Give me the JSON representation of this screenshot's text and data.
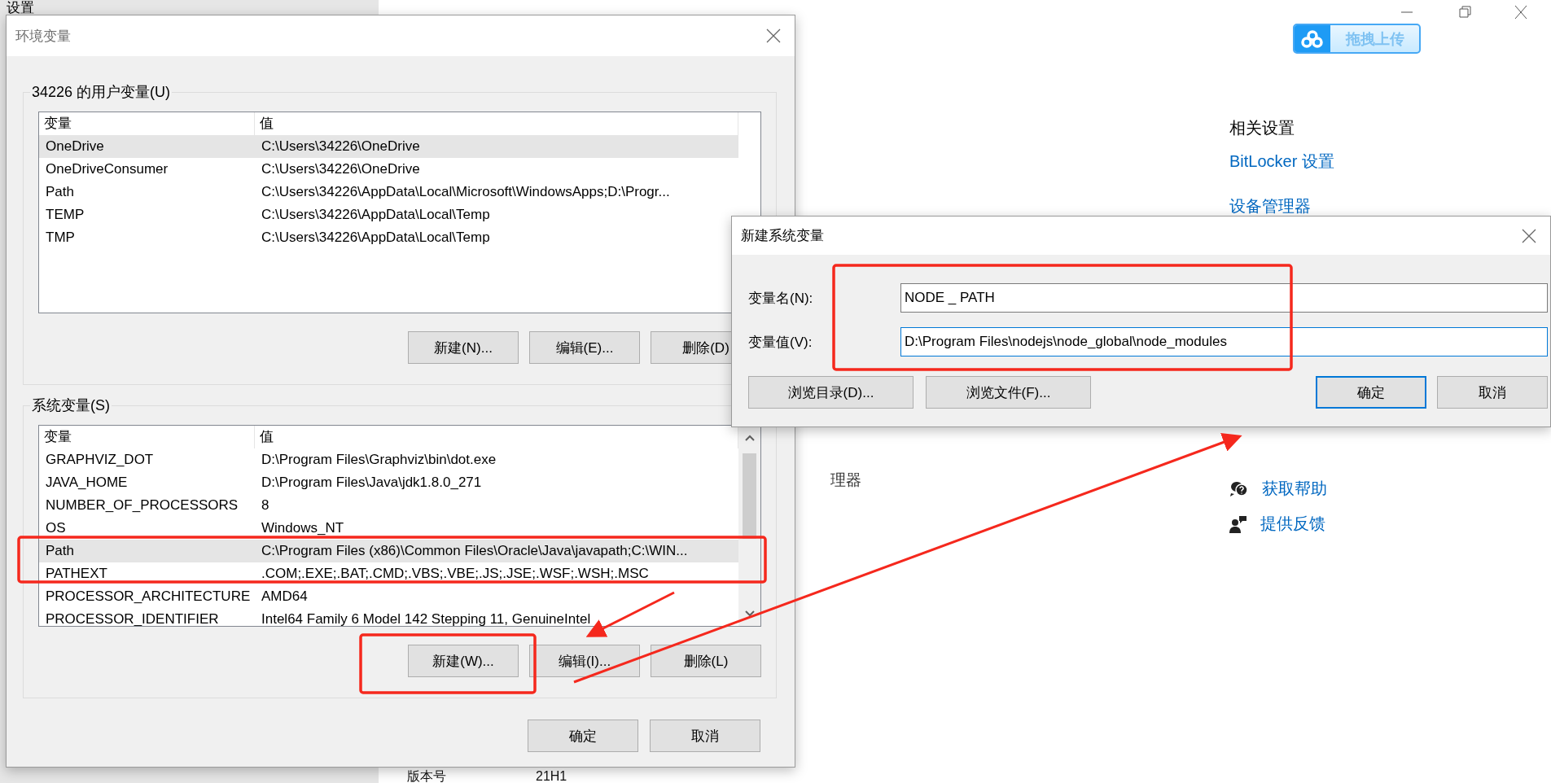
{
  "settings_window": {
    "title": "设置",
    "upload_button": "拖拽上传",
    "related_settings": {
      "heading": "相关设置",
      "links": [
        "BitLocker 设置",
        "设备管理器"
      ]
    },
    "partial_text": "理器",
    "help_links": [
      {
        "kind": "help",
        "label": "获取帮助"
      },
      {
        "kind": "feedback",
        "label": "提供反馈"
      }
    ],
    "version": {
      "label": "版本号",
      "value": "21H1"
    }
  },
  "env_dialog": {
    "title": "环境变量",
    "groups": [
      {
        "label": "34226 的用户变量(U)",
        "columns": [
          "变量",
          "值"
        ],
        "scrollbar": false,
        "rows": [
          {
            "name": "OneDrive",
            "value": "C:\\Users\\34226\\OneDrive",
            "selected": true
          },
          {
            "name": "OneDriveConsumer",
            "value": "C:\\Users\\34226\\OneDrive",
            "selected": false
          },
          {
            "name": "Path",
            "value": "C:\\Users\\34226\\AppData\\Local\\Microsoft\\WindowsApps;D:\\Progr...",
            "selected": false
          },
          {
            "name": "TEMP",
            "value": "C:\\Users\\34226\\AppData\\Local\\Temp",
            "selected": false
          },
          {
            "name": "TMP",
            "value": "C:\\Users\\34226\\AppData\\Local\\Temp",
            "selected": false
          }
        ],
        "buttons": [
          "新建(N)...",
          "编辑(E)...",
          "删除(D)"
        ]
      },
      {
        "label": "系统变量(S)",
        "columns": [
          "变量",
          "值"
        ],
        "scrollbar": true,
        "rows": [
          {
            "name": "GRAPHVIZ_DOT",
            "value": "D:\\Program Files\\Graphviz\\bin\\dot.exe",
            "selected": false
          },
          {
            "name": "JAVA_HOME",
            "value": "D:\\Program Files\\Java\\jdk1.8.0_271",
            "selected": false
          },
          {
            "name": "NUMBER_OF_PROCESSORS",
            "value": "8",
            "selected": false
          },
          {
            "name": "OS",
            "value": "Windows_NT",
            "selected": false
          },
          {
            "name": "Path",
            "value": "C:\\Program Files (x86)\\Common Files\\Oracle\\Java\\javapath;C:\\WIN...",
            "selected": true
          },
          {
            "name": "PATHEXT",
            "value": ".COM;.EXE;.BAT;.CMD;.VBS;.VBE;.JS;.JSE;.WSF;.WSH;.MSC",
            "selected": false
          },
          {
            "name": "PROCESSOR_ARCHITECTURE",
            "value": "AMD64",
            "selected": false
          },
          {
            "name": "PROCESSOR_IDENTIFIER",
            "value": "Intel64 Family 6 Model 142 Stepping 11, GenuineIntel",
            "selected": false
          }
        ],
        "buttons": [
          "新建(W)...",
          "编辑(I)...",
          "删除(L)"
        ]
      }
    ],
    "buttons": [
      "确定",
      "取消"
    ]
  },
  "new_dialog": {
    "title": "新建系统变量",
    "fields": [
      {
        "label": "变量名(N):",
        "value": "NODE _ PATH",
        "focused": false
      },
      {
        "label": "变量值(V):",
        "value": "D:\\Program Files\\nodejs\\node_global\\node_modules",
        "focused": true
      }
    ],
    "browse_buttons": [
      {
        "label": "浏览目录(D)...",
        "default": false
      },
      {
        "label": "浏览文件(F)...",
        "default": false
      }
    ],
    "buttons": [
      {
        "label": "确定",
        "default": true
      },
      {
        "label": "取消",
        "default": false
      }
    ]
  }
}
